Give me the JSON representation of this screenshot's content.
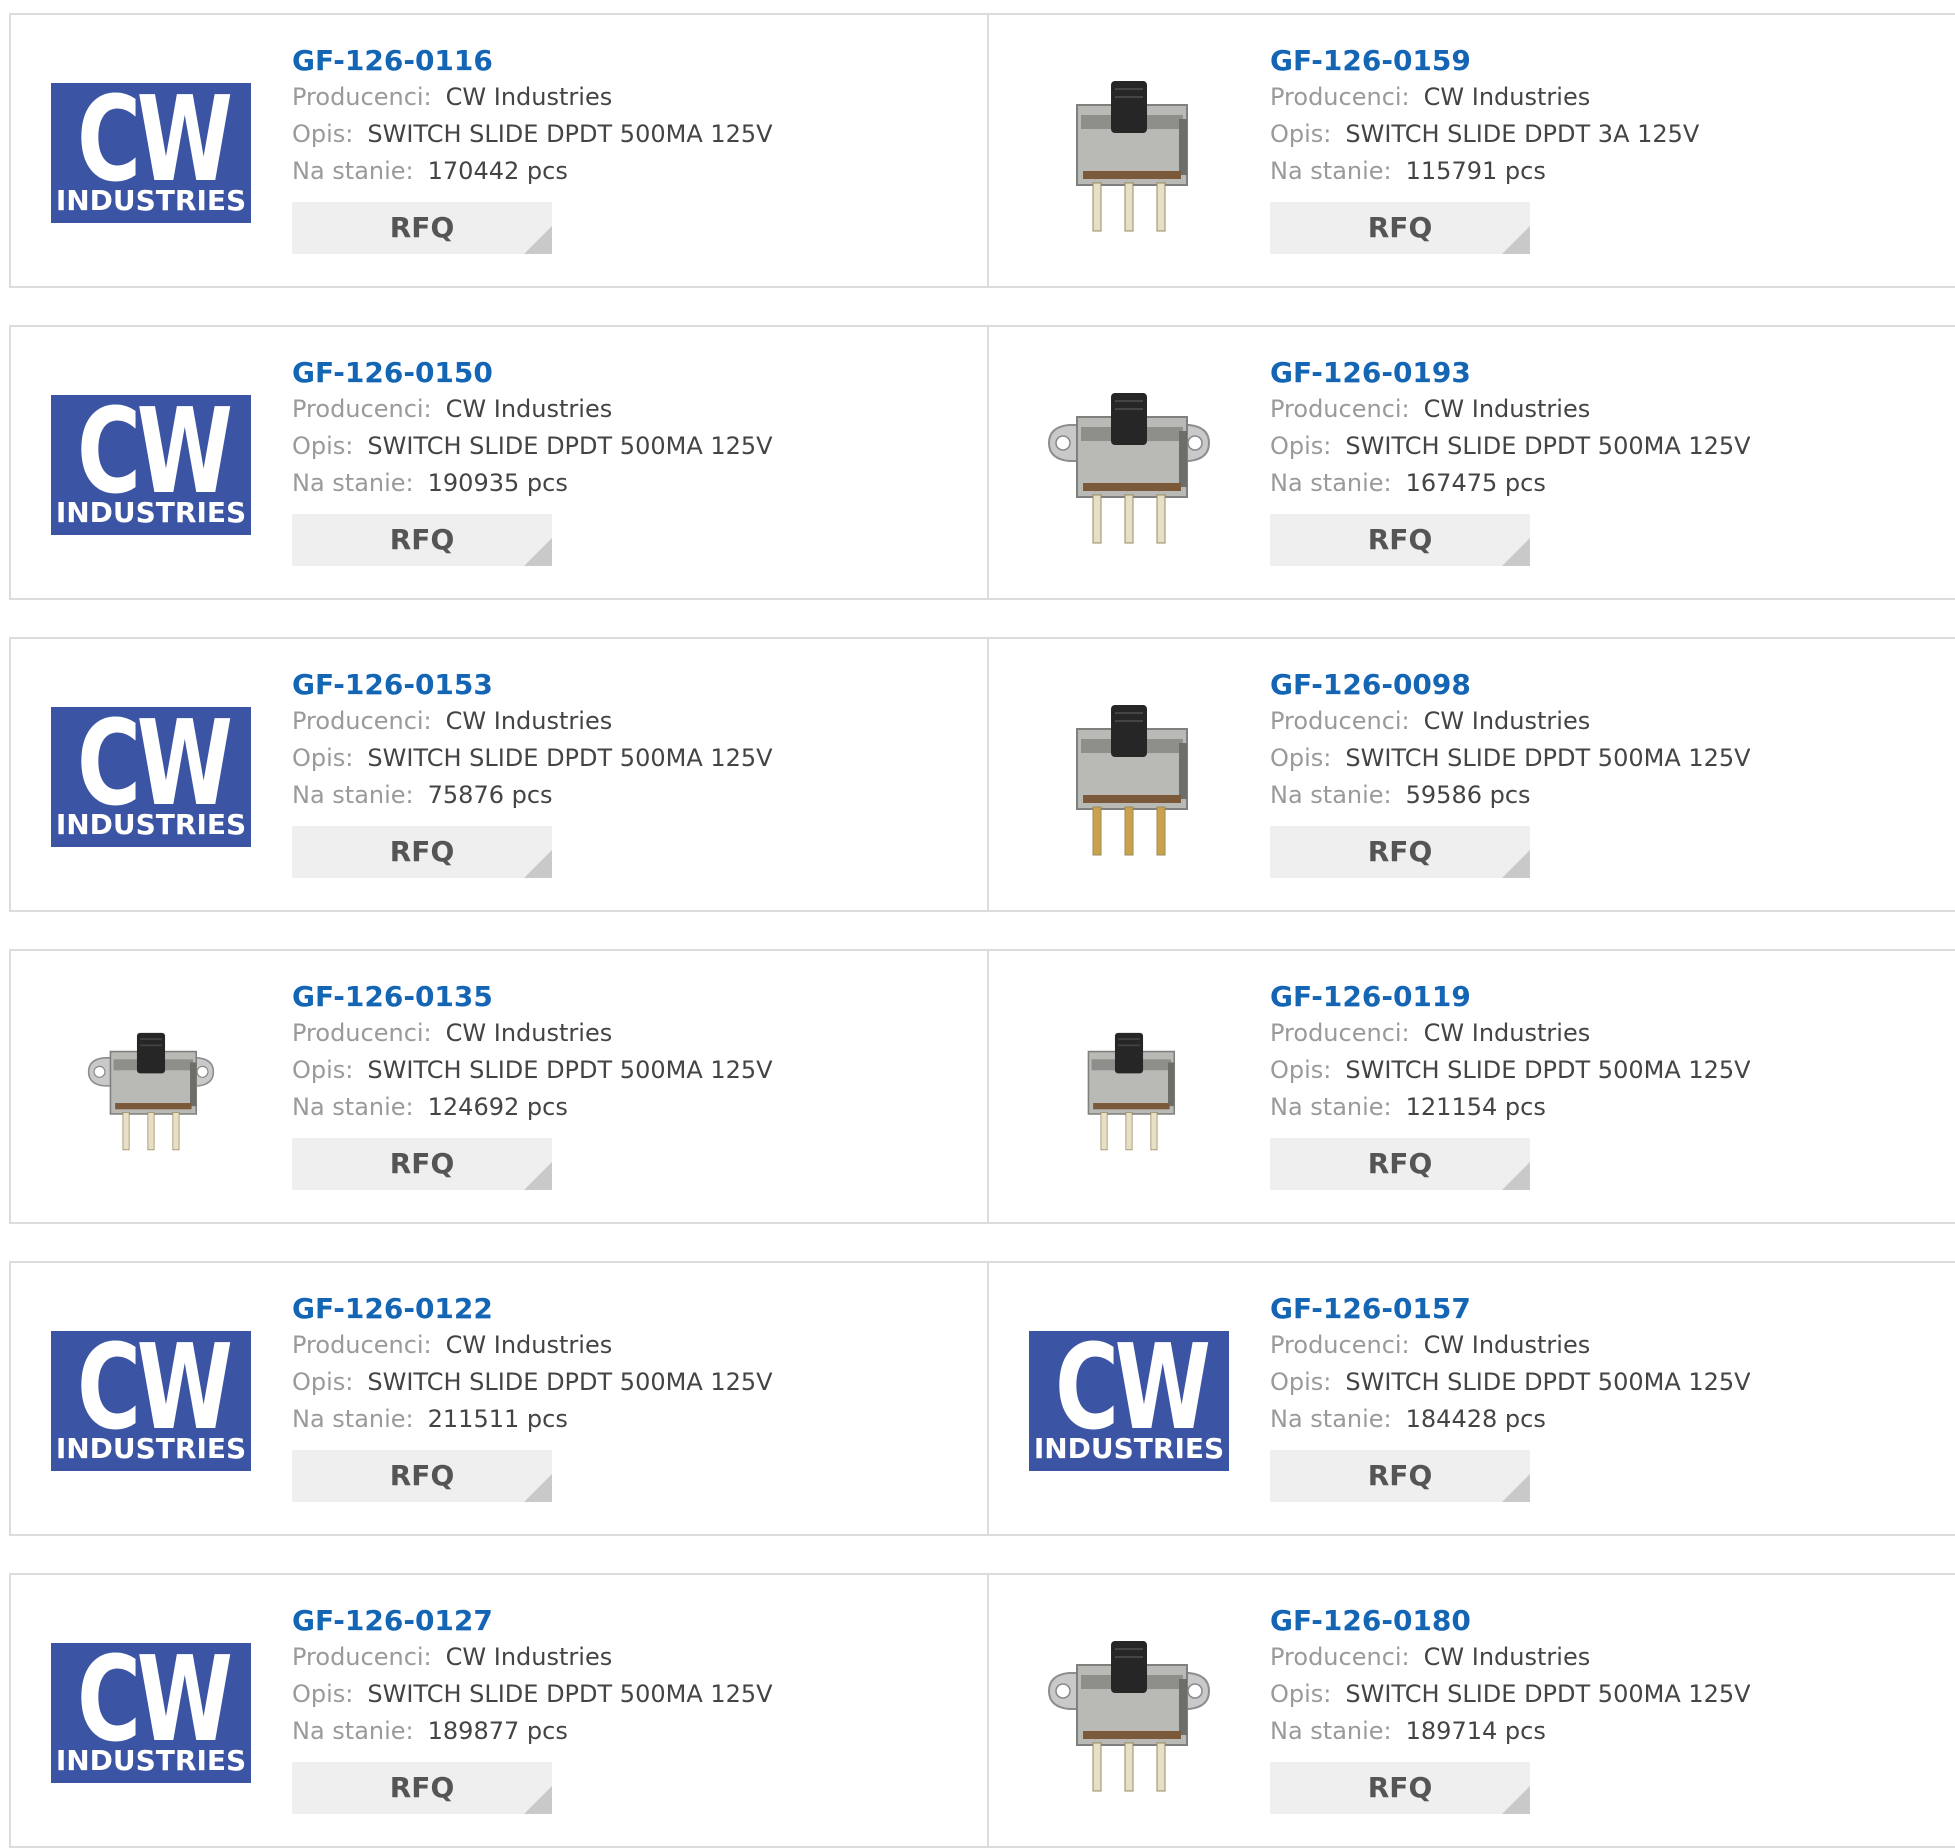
{
  "labels": {
    "manufacturer": "Producenci:",
    "description": "Opis:",
    "stock": "Na stanie:",
    "rfq": "RFQ"
  },
  "logo": {
    "letters": "CW",
    "subtitle": "INDUSTRIES",
    "bg": "#3b54a3"
  },
  "colors": {
    "part_link": "#1565b5",
    "button_bg": "#efefef",
    "border": "#dcdcdc"
  },
  "products": [
    {
      "part": "GF-126-0116",
      "manufacturer": "CW Industries",
      "description": "SWITCH SLIDE DPDT 500MA 125V",
      "stock": "170442 pcs",
      "image": "cw-industries-logo"
    },
    {
      "part": "GF-126-0159",
      "manufacturer": "CW Industries",
      "description": "SWITCH SLIDE DPDT 3A 125V",
      "stock": "115791 pcs",
      "image": "slide-switch-photo"
    },
    {
      "part": "GF-126-0150",
      "manufacturer": "CW Industries",
      "description": "SWITCH SLIDE DPDT 500MA 125V",
      "stock": "190935 pcs",
      "image": "cw-industries-logo"
    },
    {
      "part": "GF-126-0193",
      "manufacturer": "CW Industries",
      "description": "SWITCH SLIDE DPDT 500MA 125V",
      "stock": "167475 pcs",
      "image": "slide-switch-flanged-photo"
    },
    {
      "part": "GF-126-0153",
      "manufacturer": "CW Industries",
      "description": "SWITCH SLIDE DPDT 500MA 125V",
      "stock": "75876 pcs",
      "image": "cw-industries-logo"
    },
    {
      "part": "GF-126-0098",
      "manufacturer": "CW Industries",
      "description": "SWITCH SLIDE DPDT 500MA 125V",
      "stock": "59586 pcs",
      "image": "slide-switch-gold-pins-photo"
    },
    {
      "part": "GF-126-0135",
      "manufacturer": "CW Industries",
      "description": "SWITCH SLIDE DPDT 500MA 125V",
      "stock": "124692 pcs",
      "image": "slide-switch-flanged-small-photo"
    },
    {
      "part": "GF-126-0119",
      "manufacturer": "CW Industries",
      "description": "SWITCH SLIDE DPDT 500MA 125V",
      "stock": "121154 pcs",
      "image": "slide-switch-small-photo"
    },
    {
      "part": "GF-126-0122",
      "manufacturer": "CW Industries",
      "description": "SWITCH SLIDE DPDT 500MA 125V",
      "stock": "211511 pcs",
      "image": "cw-industries-logo"
    },
    {
      "part": "GF-126-0157",
      "manufacturer": "CW Industries",
      "description": "SWITCH SLIDE DPDT 500MA 125V",
      "stock": "184428 pcs",
      "image": "cw-industries-logo"
    },
    {
      "part": "GF-126-0127",
      "manufacturer": "CW Industries",
      "description": "SWITCH SLIDE DPDT 500MA 125V",
      "stock": "189877 pcs",
      "image": "cw-industries-logo"
    },
    {
      "part": "GF-126-0180",
      "manufacturer": "CW Industries",
      "description": "SWITCH SLIDE DPDT 500MA 125V",
      "stock": "189714 pcs",
      "image": "slide-switch-flanged-photo"
    }
  ]
}
